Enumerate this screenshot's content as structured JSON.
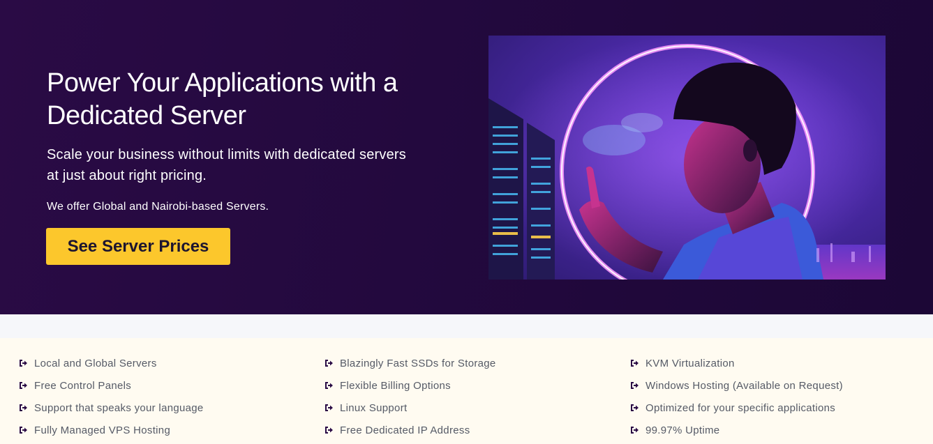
{
  "hero": {
    "title_line1": "Power Your Applications with a",
    "title_line2": "Dedicated Server",
    "subtitle_line1": "Scale your business without limits with dedicated servers",
    "subtitle_line2": "at just about right pricing.",
    "offer": "We offer Global and Nairobi-based Servers.",
    "cta_label": "See Server Prices",
    "image_icon": "server-illustration"
  },
  "features": {
    "icon": "sign-in-arrow-icon",
    "columns": [
      [
        "Local and Global Servers",
        "Free Control Panels",
        "Support that speaks your language",
        "Fully Managed VPS Hosting"
      ],
      [
        "Blazingly Fast SSDs for Storage",
        "Flexible Billing Options",
        "Linux Support",
        "Free Dedicated IP Address"
      ],
      [
        "KVM Virtualization",
        "Windows Hosting (Available on Request)",
        "Optimized for your specific applications",
        "99.97% Uptime"
      ]
    ]
  },
  "colors": {
    "hero_bg": "#23093e",
    "cta_bg": "#fcc72c",
    "feature_bg": "#fffbf1",
    "icon": "#2a0b45"
  }
}
